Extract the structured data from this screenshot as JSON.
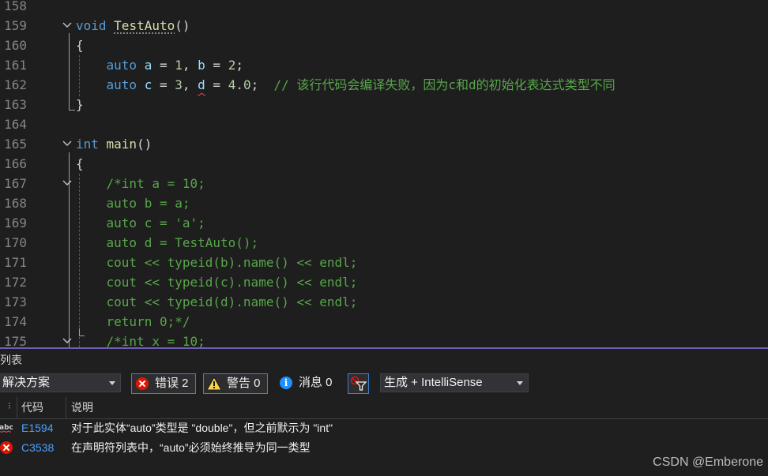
{
  "editor": {
    "lines": [
      {
        "n": "158"
      },
      {
        "n": "159",
        "tokens": [
          [
            "kw",
            "void "
          ],
          [
            "fnu",
            "TestAuto"
          ],
          [
            "pl",
            "()"
          ]
        ]
      },
      {
        "n": "160",
        "tokens": [
          [
            "pl",
            "{"
          ]
        ]
      },
      {
        "n": "161",
        "tokens": [
          [
            "pl",
            "    "
          ],
          [
            "kw",
            "auto "
          ],
          [
            "var",
            "a"
          ],
          [
            "pl",
            " = "
          ],
          [
            "num",
            "1"
          ],
          [
            "pl",
            ", "
          ],
          [
            "var",
            "b"
          ],
          [
            "pl",
            " = "
          ],
          [
            "num",
            "2"
          ],
          [
            "pl",
            ";"
          ]
        ]
      },
      {
        "n": "162",
        "tokens": [
          [
            "pl",
            "    "
          ],
          [
            "kw",
            "auto "
          ],
          [
            "var",
            "c"
          ],
          [
            "pl",
            " = "
          ],
          [
            "num",
            "3"
          ],
          [
            "pl",
            ", "
          ],
          [
            "varu",
            "d"
          ],
          [
            "pl",
            " = "
          ],
          [
            "num",
            "4.0"
          ],
          [
            "pl",
            ";  "
          ],
          [
            "cmt",
            "// 该行代码会编译失败，因为c和d的初始化表达式类型不同"
          ]
        ]
      },
      {
        "n": "163",
        "tokens": [
          [
            "pl",
            "}"
          ]
        ]
      },
      {
        "n": "164"
      },
      {
        "n": "165",
        "tokens": [
          [
            "kw",
            "int "
          ],
          [
            "fn",
            "main"
          ],
          [
            "pl",
            "()"
          ]
        ]
      },
      {
        "n": "166",
        "tokens": [
          [
            "pl",
            "{"
          ]
        ]
      },
      {
        "n": "167",
        "tokens": [
          [
            "pl",
            "    "
          ],
          [
            "cmt",
            "/*int a = 10;"
          ]
        ]
      },
      {
        "n": "168",
        "tokens": [
          [
            "pl",
            "    "
          ],
          [
            "cmt",
            "auto b = a;"
          ]
        ]
      },
      {
        "n": "169",
        "tokens": [
          [
            "pl",
            "    "
          ],
          [
            "cmt",
            "auto c = 'a';"
          ]
        ]
      },
      {
        "n": "170",
        "tokens": [
          [
            "pl",
            "    "
          ],
          [
            "cmt",
            "auto d = TestAuto();"
          ]
        ]
      },
      {
        "n": "171",
        "tokens": [
          [
            "pl",
            "    "
          ],
          [
            "cmt",
            "cout << typeid(b).name() << endl;"
          ]
        ]
      },
      {
        "n": "172",
        "tokens": [
          [
            "pl",
            "    "
          ],
          [
            "cmt",
            "cout << typeid(c).name() << endl;"
          ]
        ]
      },
      {
        "n": "173",
        "tokens": [
          [
            "pl",
            "    "
          ],
          [
            "cmt",
            "cout << typeid(d).name() << endl;"
          ]
        ]
      },
      {
        "n": "174",
        "tokens": [
          [
            "pl",
            "    "
          ],
          [
            "cmt",
            "return 0;*/"
          ]
        ]
      },
      {
        "n": "175",
        "tokens": [
          [
            "pl",
            "    "
          ],
          [
            "cmt",
            "/*int x = 10;"
          ]
        ]
      }
    ]
  },
  "error_list": {
    "title": "列表",
    "scope_dropdown": "解决方案",
    "errors_button": "错误 2",
    "warnings_button": "警告 0",
    "messages_label": "消息 0",
    "build_dropdown": "生成 + IntelliSense",
    "columns": {
      "code": "代码",
      "description": "说明"
    },
    "rows": [
      {
        "icon": "abc",
        "code": "E1594",
        "description": "对于此实体“auto”类型是 \"double\"，但之前默示为 \"int\""
      },
      {
        "icon": "error",
        "code": "C3538",
        "description": "在声明符列表中，“auto”必须始终推导为同一类型"
      }
    ]
  },
  "watermark": "CSDN @Emberone"
}
